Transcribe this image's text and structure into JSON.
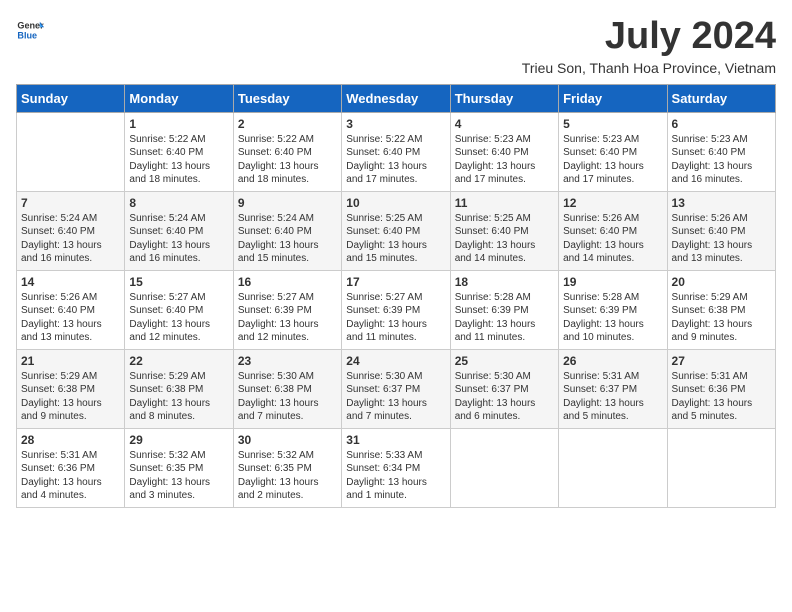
{
  "header": {
    "logo_line1": "General",
    "logo_line2": "Blue",
    "month_year": "July 2024",
    "location": "Trieu Son, Thanh Hoa Province, Vietnam"
  },
  "days_of_week": [
    "Sunday",
    "Monday",
    "Tuesday",
    "Wednesday",
    "Thursday",
    "Friday",
    "Saturday"
  ],
  "weeks": [
    [
      {
        "day": "",
        "sunrise": "",
        "sunset": "",
        "daylight": ""
      },
      {
        "day": "1",
        "sunrise": "Sunrise: 5:22 AM",
        "sunset": "Sunset: 6:40 PM",
        "daylight": "Daylight: 13 hours and 18 minutes."
      },
      {
        "day": "2",
        "sunrise": "Sunrise: 5:22 AM",
        "sunset": "Sunset: 6:40 PM",
        "daylight": "Daylight: 13 hours and 18 minutes."
      },
      {
        "day": "3",
        "sunrise": "Sunrise: 5:22 AM",
        "sunset": "Sunset: 6:40 PM",
        "daylight": "Daylight: 13 hours and 17 minutes."
      },
      {
        "day": "4",
        "sunrise": "Sunrise: 5:23 AM",
        "sunset": "Sunset: 6:40 PM",
        "daylight": "Daylight: 13 hours and 17 minutes."
      },
      {
        "day": "5",
        "sunrise": "Sunrise: 5:23 AM",
        "sunset": "Sunset: 6:40 PM",
        "daylight": "Daylight: 13 hours and 17 minutes."
      },
      {
        "day": "6",
        "sunrise": "Sunrise: 5:23 AM",
        "sunset": "Sunset: 6:40 PM",
        "daylight": "Daylight: 13 hours and 16 minutes."
      }
    ],
    [
      {
        "day": "7",
        "sunrise": "Sunrise: 5:24 AM",
        "sunset": "Sunset: 6:40 PM",
        "daylight": "Daylight: 13 hours and 16 minutes."
      },
      {
        "day": "8",
        "sunrise": "Sunrise: 5:24 AM",
        "sunset": "Sunset: 6:40 PM",
        "daylight": "Daylight: 13 hours and 16 minutes."
      },
      {
        "day": "9",
        "sunrise": "Sunrise: 5:24 AM",
        "sunset": "Sunset: 6:40 PM",
        "daylight": "Daylight: 13 hours and 15 minutes."
      },
      {
        "day": "10",
        "sunrise": "Sunrise: 5:25 AM",
        "sunset": "Sunset: 6:40 PM",
        "daylight": "Daylight: 13 hours and 15 minutes."
      },
      {
        "day": "11",
        "sunrise": "Sunrise: 5:25 AM",
        "sunset": "Sunset: 6:40 PM",
        "daylight": "Daylight: 13 hours and 14 minutes."
      },
      {
        "day": "12",
        "sunrise": "Sunrise: 5:26 AM",
        "sunset": "Sunset: 6:40 PM",
        "daylight": "Daylight: 13 hours and 14 minutes."
      },
      {
        "day": "13",
        "sunrise": "Sunrise: 5:26 AM",
        "sunset": "Sunset: 6:40 PM",
        "daylight": "Daylight: 13 hours and 13 minutes."
      }
    ],
    [
      {
        "day": "14",
        "sunrise": "Sunrise: 5:26 AM",
        "sunset": "Sunset: 6:40 PM",
        "daylight": "Daylight: 13 hours and 13 minutes."
      },
      {
        "day": "15",
        "sunrise": "Sunrise: 5:27 AM",
        "sunset": "Sunset: 6:40 PM",
        "daylight": "Daylight: 13 hours and 12 minutes."
      },
      {
        "day": "16",
        "sunrise": "Sunrise: 5:27 AM",
        "sunset": "Sunset: 6:39 PM",
        "daylight": "Daylight: 13 hours and 12 minutes."
      },
      {
        "day": "17",
        "sunrise": "Sunrise: 5:27 AM",
        "sunset": "Sunset: 6:39 PM",
        "daylight": "Daylight: 13 hours and 11 minutes."
      },
      {
        "day": "18",
        "sunrise": "Sunrise: 5:28 AM",
        "sunset": "Sunset: 6:39 PM",
        "daylight": "Daylight: 13 hours and 11 minutes."
      },
      {
        "day": "19",
        "sunrise": "Sunrise: 5:28 AM",
        "sunset": "Sunset: 6:39 PM",
        "daylight": "Daylight: 13 hours and 10 minutes."
      },
      {
        "day": "20",
        "sunrise": "Sunrise: 5:29 AM",
        "sunset": "Sunset: 6:38 PM",
        "daylight": "Daylight: 13 hours and 9 minutes."
      }
    ],
    [
      {
        "day": "21",
        "sunrise": "Sunrise: 5:29 AM",
        "sunset": "Sunset: 6:38 PM",
        "daylight": "Daylight: 13 hours and 9 minutes."
      },
      {
        "day": "22",
        "sunrise": "Sunrise: 5:29 AM",
        "sunset": "Sunset: 6:38 PM",
        "daylight": "Daylight: 13 hours and 8 minutes."
      },
      {
        "day": "23",
        "sunrise": "Sunrise: 5:30 AM",
        "sunset": "Sunset: 6:38 PM",
        "daylight": "Daylight: 13 hours and 7 minutes."
      },
      {
        "day": "24",
        "sunrise": "Sunrise: 5:30 AM",
        "sunset": "Sunset: 6:37 PM",
        "daylight": "Daylight: 13 hours and 7 minutes."
      },
      {
        "day": "25",
        "sunrise": "Sunrise: 5:30 AM",
        "sunset": "Sunset: 6:37 PM",
        "daylight": "Daylight: 13 hours and 6 minutes."
      },
      {
        "day": "26",
        "sunrise": "Sunrise: 5:31 AM",
        "sunset": "Sunset: 6:37 PM",
        "daylight": "Daylight: 13 hours and 5 minutes."
      },
      {
        "day": "27",
        "sunrise": "Sunrise: 5:31 AM",
        "sunset": "Sunset: 6:36 PM",
        "daylight": "Daylight: 13 hours and 5 minutes."
      }
    ],
    [
      {
        "day": "28",
        "sunrise": "Sunrise: 5:31 AM",
        "sunset": "Sunset: 6:36 PM",
        "daylight": "Daylight: 13 hours and 4 minutes."
      },
      {
        "day": "29",
        "sunrise": "Sunrise: 5:32 AM",
        "sunset": "Sunset: 6:35 PM",
        "daylight": "Daylight: 13 hours and 3 minutes."
      },
      {
        "day": "30",
        "sunrise": "Sunrise: 5:32 AM",
        "sunset": "Sunset: 6:35 PM",
        "daylight": "Daylight: 13 hours and 2 minutes."
      },
      {
        "day": "31",
        "sunrise": "Sunrise: 5:33 AM",
        "sunset": "Sunset: 6:34 PM",
        "daylight": "Daylight: 13 hours and 1 minute."
      },
      {
        "day": "",
        "sunrise": "",
        "sunset": "",
        "daylight": ""
      },
      {
        "day": "",
        "sunrise": "",
        "sunset": "",
        "daylight": ""
      },
      {
        "day": "",
        "sunrise": "",
        "sunset": "",
        "daylight": ""
      }
    ]
  ]
}
